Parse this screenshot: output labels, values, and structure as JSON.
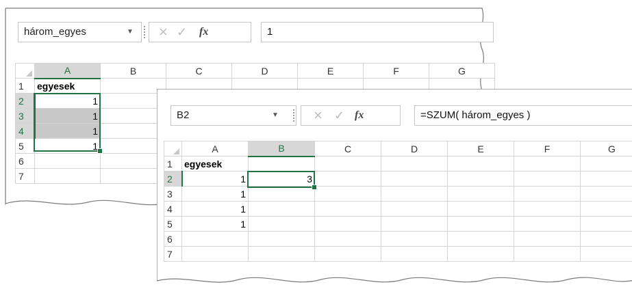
{
  "back": {
    "name_box": "három_egyes",
    "formula": "1",
    "fx_label": "fx",
    "columns": [
      "A",
      "B",
      "C",
      "D",
      "E",
      "F",
      "G"
    ],
    "rows": [
      "1",
      "2",
      "3",
      "4",
      "5",
      "6",
      "7"
    ],
    "cells": {
      "A1": "egyesek",
      "A2": "1",
      "A3": "1",
      "A4": "1",
      "A5": "1"
    }
  },
  "front": {
    "name_box": "B2",
    "formula": "=SZUM( három_egyes )",
    "fx_label": "fx",
    "columns": [
      "A",
      "B",
      "C",
      "D",
      "E",
      "F",
      "G"
    ],
    "rows": [
      "1",
      "2",
      "3",
      "4",
      "5",
      "6",
      "7"
    ],
    "cells": {
      "A1": "egyesek",
      "A2": "1",
      "A3": "1",
      "A4": "1",
      "A5": "1",
      "B2": "3"
    }
  },
  "colors": {
    "accent": "#217346",
    "selection_shade": "#c8c8c8"
  },
  "icons": {
    "cancel": "×",
    "enter": "✓",
    "dropdown": "▼"
  }
}
